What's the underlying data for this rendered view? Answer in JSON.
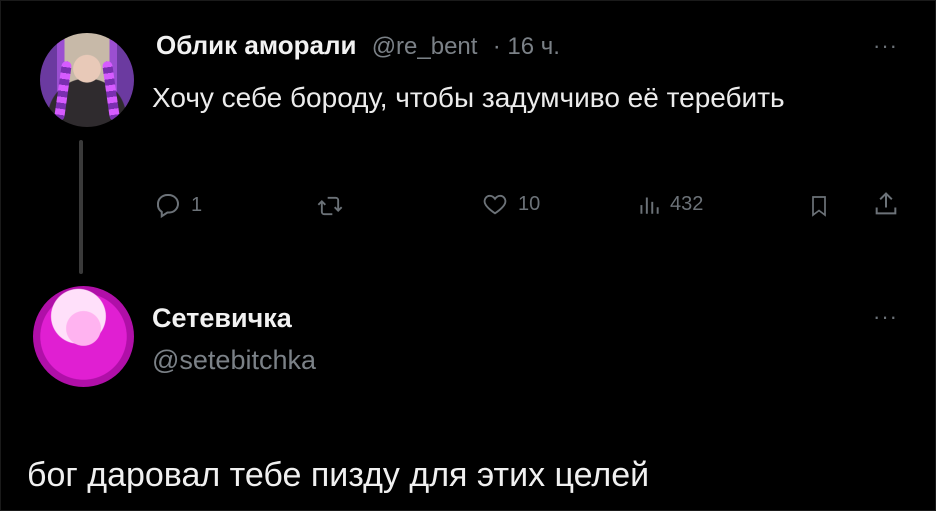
{
  "tweet": {
    "author_name": "Облик аморали",
    "author_handle": "@re_bent",
    "time": "· 16 ч.",
    "text": "Хочу себе бороду, чтобы задумчиво её теребить",
    "more_label": "···",
    "actions": {
      "replies": "1",
      "retweets": "",
      "likes": "10",
      "views": "432"
    }
  },
  "reply": {
    "author_name": "Сетевичка",
    "author_handle": "@setebitchka",
    "more_label": "···",
    "text": "бог даровал тебе пизду для этих целей"
  },
  "colors": {
    "background": "#000000",
    "text": "#e7e9ea",
    "muted": "#6c7278",
    "avatar_accent": "#e01fd2"
  },
  "icons": [
    "reply-icon",
    "retweet-icon",
    "like-icon",
    "views-icon",
    "bookmark-icon",
    "share-icon"
  ]
}
